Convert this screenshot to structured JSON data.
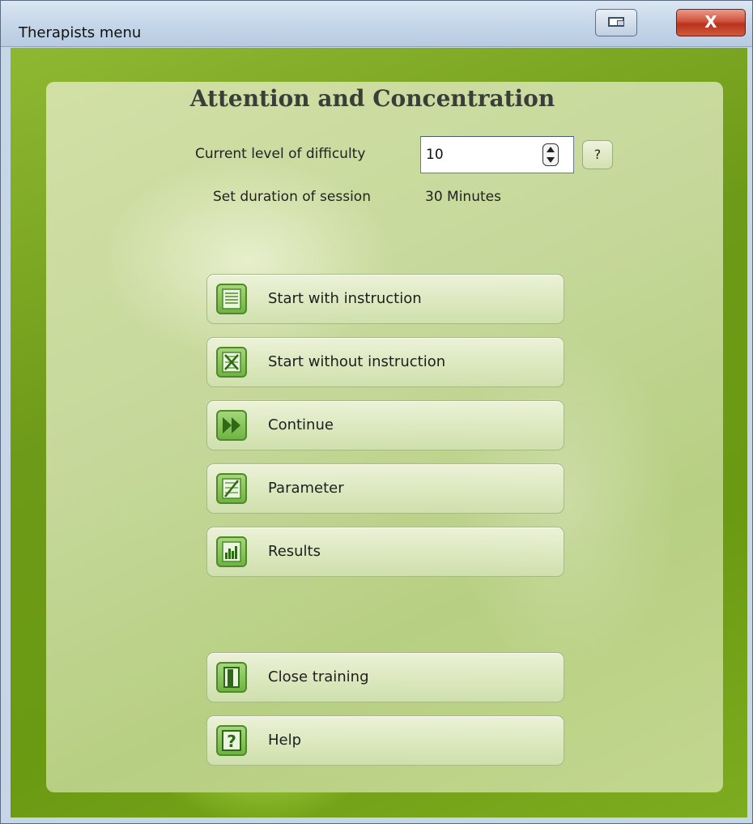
{
  "window": {
    "title": "Therapists menu",
    "close_glyph": "X"
  },
  "panel": {
    "heading": "Attention and Concentration",
    "level_label": "Current level of difficulty",
    "level_value": "10",
    "help_small": "?",
    "duration_label": "Set duration of session",
    "duration_value": "30 Minutes"
  },
  "buttons": [
    {
      "label": "Start with instruction",
      "icon": "list-icon"
    },
    {
      "label": "Start without instruction",
      "icon": "crossed-list-icon"
    },
    {
      "label": "Continue",
      "icon": "fast-forward-icon"
    },
    {
      "label": "Parameter",
      "icon": "parameter-icon"
    },
    {
      "label": "Results",
      "icon": "bar-chart-icon"
    },
    {
      "label": "Close training",
      "icon": "exit-door-icon"
    },
    {
      "label": "Help",
      "icon": "question-icon"
    }
  ],
  "colors": {
    "outer_green": "#6d9a18",
    "panel_green": "#c5d89a",
    "icon_green": "#6fb443"
  }
}
